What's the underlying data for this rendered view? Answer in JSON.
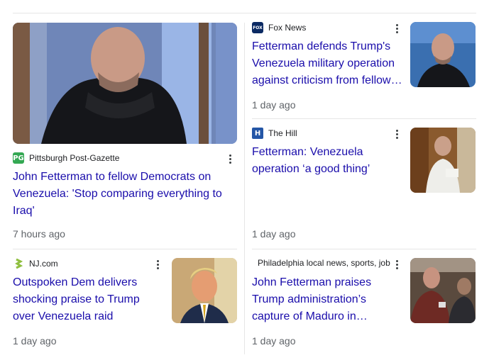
{
  "top_stories": [
    {
      "source": "Pittsburgh Post-Gazette",
      "favicon": "pg-logo-icon",
      "headline": "John Fetterman to fellow Democrats on Venezuela: 'Stop comparing everything to Iraq'",
      "time": "7 hours ago",
      "image": "fetterman-profile-photo"
    },
    {
      "source": "NJ.com",
      "favicon": "njcom-logo-icon",
      "headline": "Outspoken Dem delivers shocking praise to Trump over Venezuela raid",
      "time": "1 day ago",
      "image": "trump-portrait-photo"
    },
    {
      "source": "Fox News",
      "favicon": "fox-news-logo-icon",
      "headline": "Fetterman defends Trump's Venezuela military operation against criticism from fellow…",
      "time": "1 day ago",
      "image": "fetterman-photo"
    },
    {
      "source": "The Hill",
      "favicon": "the-hill-logo-icon",
      "headline": "Fetterman: Venezuela operation ‘a good thing’",
      "time": "1 day ago",
      "image": "fetterman-capitol-photo"
    },
    {
      "source": "Philadelphia local news, sports, job",
      "favicon": "",
      "headline": "John Fetterman praises Trump administration’s capture of Maduro in…",
      "time": "1 day ago",
      "image": "fetterman-press-gaggle-photo"
    }
  ],
  "colors": {
    "headline": "#1a0dab",
    "meta": "#5f6368",
    "divider": "#e6e6e6",
    "pg_green": "#34a853",
    "hill_blue": "#2456a6",
    "fox_navy": "#0b2a63"
  }
}
